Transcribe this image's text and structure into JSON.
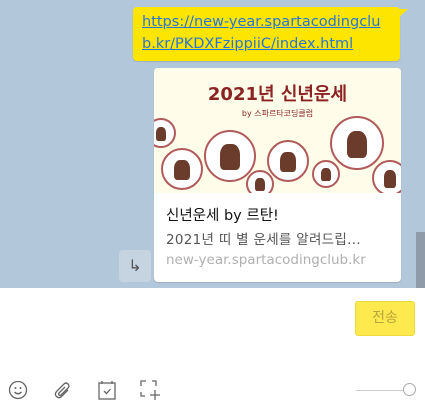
{
  "message": {
    "link": "https://new-year.spartacodingclub.kr/PKDXFzippiiC/index.html"
  },
  "preview": {
    "image_title": "2021년 신년운세",
    "image_subtitle": "by 스파르타코딩클럽",
    "title": "신년운세 by 르탄!",
    "description": "2021년 띠 별 운세를 알려드립...",
    "domain": "new-year.spartacodingclub.kr"
  },
  "composer": {
    "send_label": "전송",
    "zoom_level": 1.0
  },
  "colors": {
    "chat_bg": "#b2c7d9",
    "bubble": "#fee500",
    "send": "#fee94e"
  }
}
